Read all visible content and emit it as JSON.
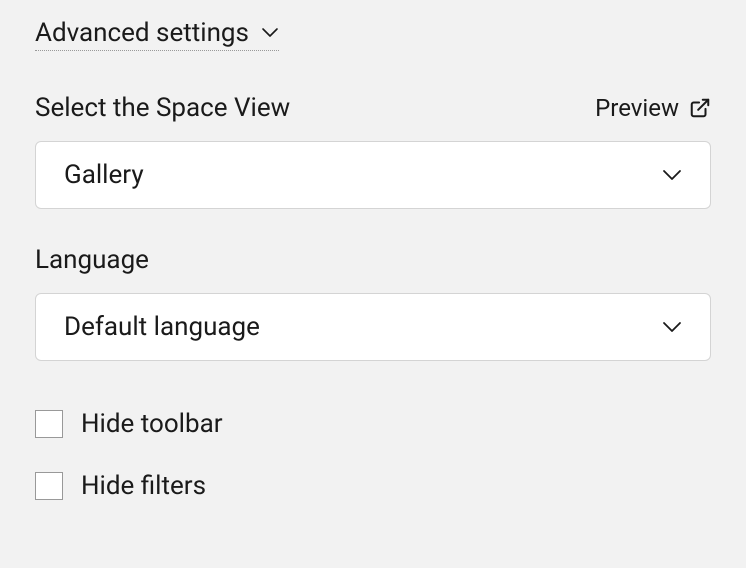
{
  "section": {
    "title": "Advanced settings"
  },
  "spaceView": {
    "label": "Select the Space View",
    "previewLabel": "Preview",
    "value": "Gallery"
  },
  "language": {
    "label": "Language",
    "value": "Default language"
  },
  "checkboxes": {
    "hideToolbar": "Hide toolbar",
    "hideFilters": "Hide filters"
  }
}
